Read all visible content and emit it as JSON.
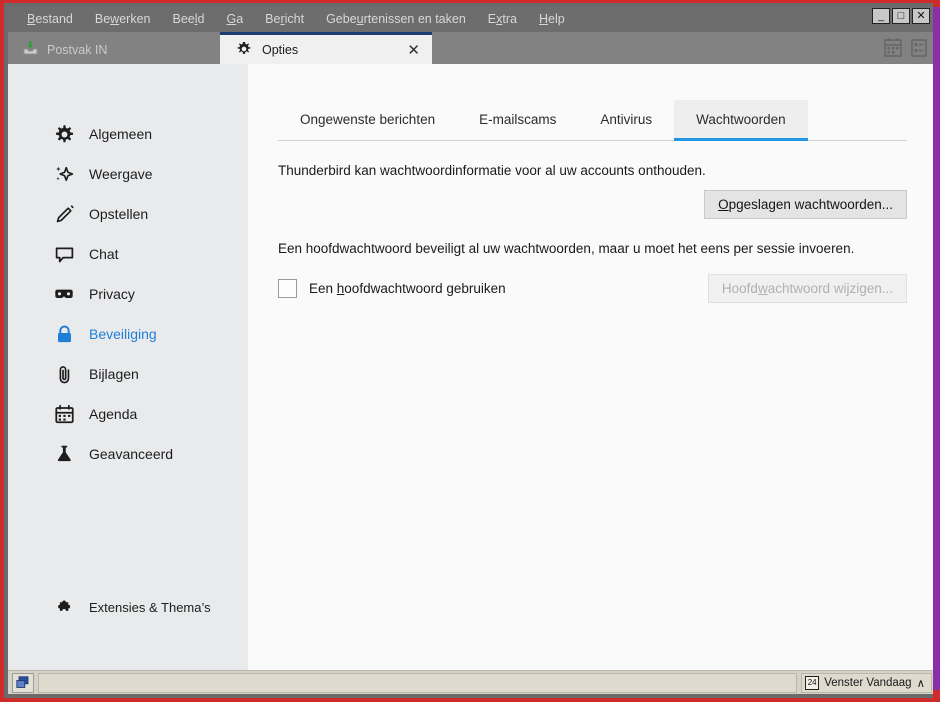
{
  "window": {
    "minimize_label": "_",
    "maximize_label": "□",
    "close_label": "✕",
    "border_color": "#d02b2b",
    "border_color_right": "#8b2fa8"
  },
  "menubar": {
    "items": [
      {
        "label": "Bestand",
        "accesskey": "B"
      },
      {
        "label": "Bewerken",
        "accesskey": "w"
      },
      {
        "label": "Beeld",
        "accesskey": "l"
      },
      {
        "label": "Ga",
        "accesskey": "G"
      },
      {
        "label": "Bericht",
        "accesskey": "r"
      },
      {
        "label": "Gebeurtenissen en taken",
        "accesskey": "u"
      },
      {
        "label": "Extra",
        "accesskey": "x"
      },
      {
        "label": "Help",
        "accesskey": "H"
      }
    ]
  },
  "tabs": {
    "inbox": {
      "label": "Postvak IN",
      "icon": "inbox-icon"
    },
    "options": {
      "label": "Opties",
      "icon": "gear-icon",
      "close_label": "✕",
      "active": true
    },
    "right_icons": [
      "calendar-icon",
      "tasks-icon"
    ]
  },
  "sidebar": {
    "items": [
      {
        "label": "Algemeen",
        "icon": "gear-icon",
        "selected": false
      },
      {
        "label": "Weergave",
        "icon": "sparkle-icon",
        "selected": false
      },
      {
        "label": "Opstellen",
        "icon": "pencil-icon",
        "selected": false
      },
      {
        "label": "Chat",
        "icon": "chat-bubble-icon",
        "selected": false
      },
      {
        "label": "Privacy",
        "icon": "mask-icon",
        "selected": false
      },
      {
        "label": "Beveiliging",
        "icon": "lock-icon",
        "selected": true
      },
      {
        "label": "Bijlagen",
        "icon": "paperclip-icon",
        "selected": false
      },
      {
        "label": "Agenda",
        "icon": "calendar-icon",
        "selected": false
      },
      {
        "label": "Geavanceerd",
        "icon": "flask-icon",
        "selected": false
      }
    ],
    "extensions": {
      "label": "Extensies & Thema’s",
      "icon": "puzzle-piece-icon"
    },
    "selected_color": "#1f7fd6"
  },
  "main": {
    "tabs": [
      {
        "label": "Ongewenste berichten",
        "active": false
      },
      {
        "label": "E-mailscams",
        "active": false
      },
      {
        "label": "Antivirus",
        "active": false
      },
      {
        "label": "Wachtwoorden",
        "active": true
      }
    ],
    "active_tab_underline_color": "#2196e3",
    "passwords": {
      "description": "Thunderbird kan wachtwoordinformatie voor al uw accounts onthouden.",
      "saved_button": {
        "label": "Opgeslagen wachtwoorden...",
        "accesskey": "O",
        "enabled": true
      },
      "master_description": "Een hoofdwachtwoord beveiligt al uw wachtwoorden, maar u moet het eens per sessie invoeren.",
      "master_checkbox": {
        "label": "Een hoofdwachtwoord gebruiken",
        "accesskey": "h",
        "checked": false
      },
      "change_button": {
        "label": "Hoofdwachtwoord wijzigen...",
        "accesskey": "w",
        "enabled": false
      }
    }
  },
  "statusbar": {
    "message": "",
    "today_pane": {
      "label": "Venster Vandaag",
      "icon": "calendar-24-icon",
      "chevron": "∧",
      "day_number": "24"
    }
  }
}
